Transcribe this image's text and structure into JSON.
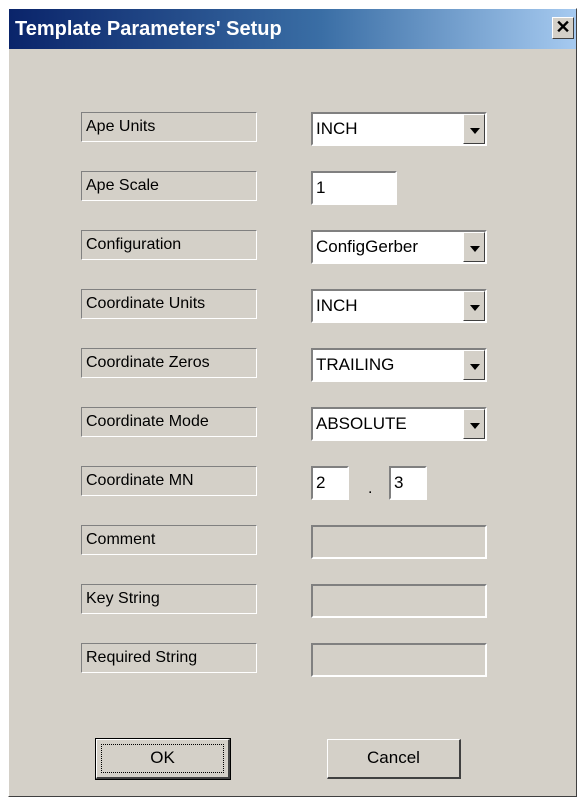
{
  "window": {
    "title": "Template Parameters' Setup",
    "close": "✕"
  },
  "fields": {
    "ape_units": {
      "label": "Ape Units",
      "value": "INCH"
    },
    "ape_scale": {
      "label": "Ape Scale",
      "value": "1"
    },
    "configuration": {
      "label": "Configuration",
      "value": "ConfigGerber"
    },
    "coordinate_units": {
      "label": "Coordinate Units",
      "value": "INCH"
    },
    "coordinate_zeros": {
      "label": "Coordinate Zeros",
      "value": "TRAILING"
    },
    "coordinate_mode": {
      "label": "Coordinate Mode",
      "value": "ABSOLUTE"
    },
    "coordinate_mn": {
      "label": "Coordinate MN",
      "m": "2",
      "separator": ".",
      "n": "3"
    },
    "comment": {
      "label": "Comment",
      "value": ""
    },
    "key_string": {
      "label": "Key String",
      "value": ""
    },
    "required_string": {
      "label": "Required String",
      "value": ""
    }
  },
  "buttons": {
    "ok": "OK",
    "cancel": "Cancel"
  }
}
